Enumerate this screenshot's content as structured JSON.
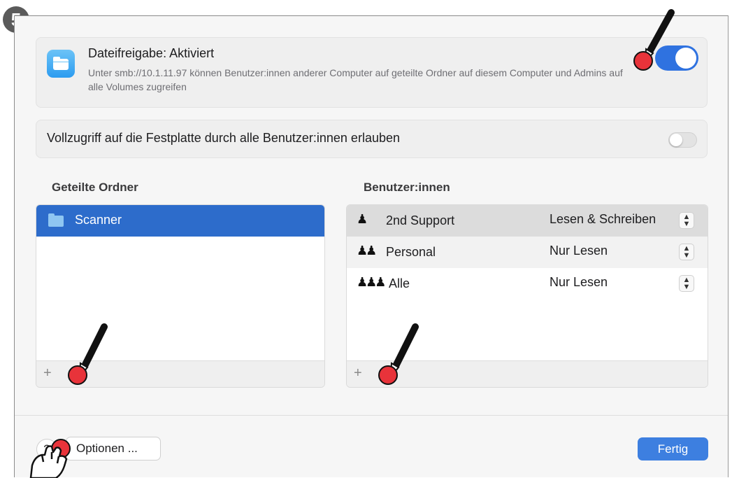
{
  "step": "5",
  "file_sharing": {
    "title": "Dateifreigabe: Aktiviert",
    "description": "Unter smb://10.1.11.97 können Benutzer:innen anderer Computer auf geteilte Ordner auf diesem Computer und Admins auf alle Volumes zugreifen",
    "enabled": true
  },
  "full_disk_access": {
    "label": "Vollzugriff auf die Festplatte durch alle Benutzer:innen erlauben",
    "enabled": false
  },
  "shared_folders": {
    "title": "Geteilte Ordner",
    "items": [
      {
        "name": "Scanner"
      }
    ],
    "add_label": "+"
  },
  "users": {
    "title": "Benutzer:innen",
    "items": [
      {
        "icon": "single-user-icon",
        "name": "2nd Support",
        "permission": "Lesen & Schreiben"
      },
      {
        "icon": "group-icon",
        "name": "Personal",
        "permission": "Nur Lesen"
      },
      {
        "icon": "everyone-icon",
        "name": "Alle",
        "permission": "Nur Lesen"
      }
    ],
    "add_label": "+"
  },
  "footer": {
    "help_label": "?",
    "options_label": "Optionen ...",
    "done_label": "Fertig"
  },
  "colors": {
    "accent": "#2f72e0",
    "selection": "#2d6ccb",
    "marker_red": "#e8333a"
  }
}
